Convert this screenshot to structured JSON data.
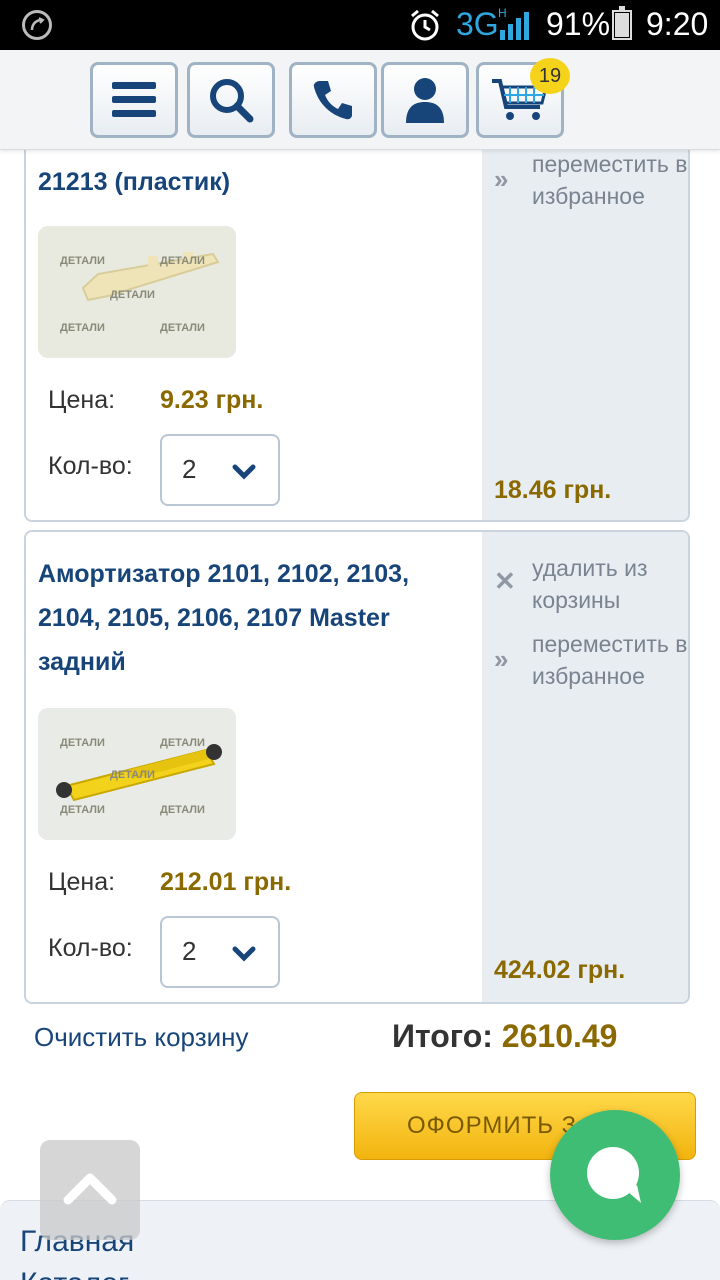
{
  "status_bar": {
    "network": "3G",
    "network_sup": "H",
    "battery": "91%",
    "battery_level": 0.91,
    "time": "9:20"
  },
  "toolbar": {
    "buttons": [
      "menu-icon",
      "search-icon",
      "phone-icon",
      "user-icon",
      "cart-icon"
    ],
    "cart_count": "19"
  },
  "items": [
    {
      "title": "21213 (пластик)",
      "price_label": "Цена:",
      "price": "9.23 грн.",
      "qty_label": "Кол-во:",
      "qty": "2",
      "move_to_favorites": "переместить в избранное",
      "total": "18.46 грн."
    },
    {
      "title": "Амортизатор 2101, 2102, 2103, 2104, 2105, 2106, 2107 Master задний",
      "price_label": "Цена:",
      "price": "212.01 грн.",
      "qty_label": "Кол-во:",
      "qty": "2",
      "remove_from_cart": "удалить из корзины",
      "move_to_favorites": "переместить в избранное",
      "total": "424.02 грн."
    }
  ],
  "watermark": "ДЕТАЛИ",
  "clear_cart": "Очистить корзину",
  "total_label": "Итого:",
  "total_value": "2610.49",
  "checkout_label": "ОФОРМИТЬ З",
  "footer_nav": [
    "Главная",
    "Каталог"
  ],
  "colors": {
    "brand_blue": "#17457a",
    "price_gold": "#8a6a00",
    "checkout_yellow": "#f6c21a",
    "chat_green": "#3fbd74"
  }
}
